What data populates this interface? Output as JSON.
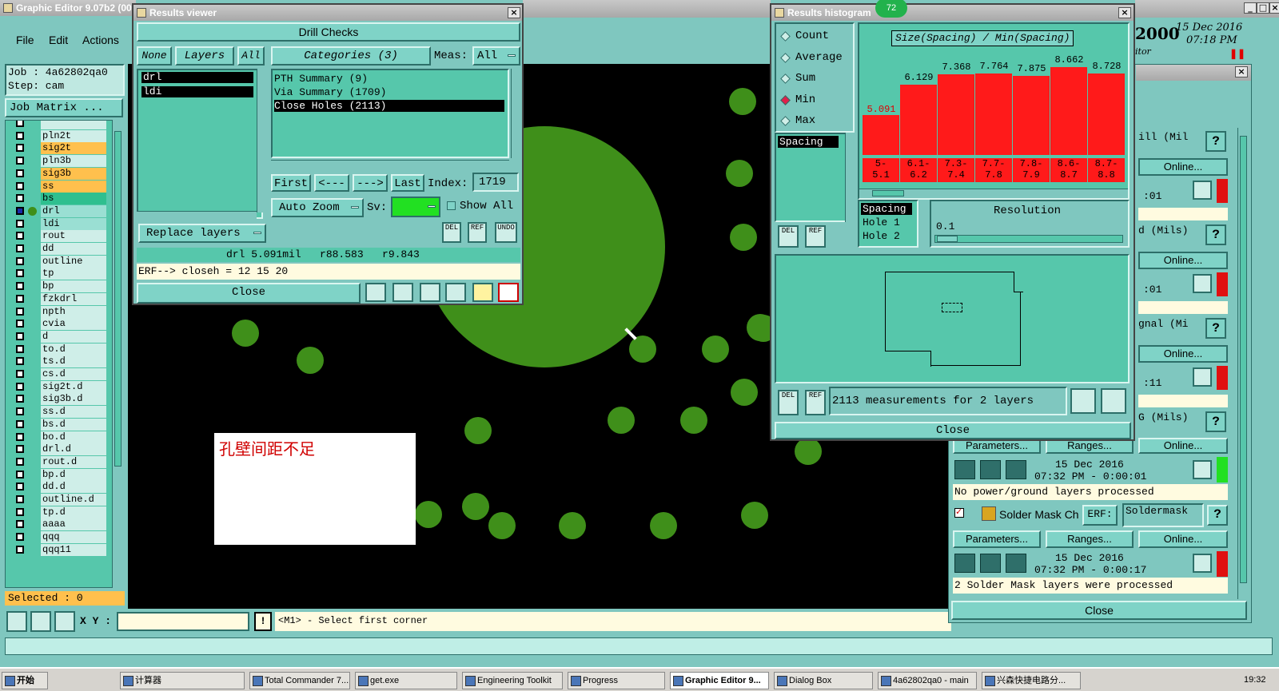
{
  "main_window": {
    "title": "Graphic Editor 9.07b2 (00",
    "menu": [
      "File",
      "Edit",
      "Actions"
    ],
    "job_line": "Job : 4a62802qa0",
    "step_line": "Step: cam",
    "job_matrix_label": "Job Matrix ...",
    "selected_label": "Selected : 0",
    "xy_label": "X Y :",
    "status_prompt": "<M1> - Select first corner",
    "date": "15 Dec 2016",
    "time": "07:18 PM",
    "year_fragment": "2000",
    "editor_fragment": "itor",
    "pause_icon": "❚❚"
  },
  "layers": [
    "",
    "pln2t",
    "sig2t",
    "pln3b",
    "sig3b",
    "ss",
    "bs",
    "drl",
    "ldi",
    "rout",
    "dd",
    "outline",
    "tp",
    "bp",
    "fzkdrl",
    "npth",
    "cvia",
    "d",
    "to.d",
    "ts.d",
    "cs.d",
    "sig2t.d",
    "sig3b.d",
    "ss.d",
    "bs.d",
    "bo.d",
    "drl.d",
    "rout.d",
    "bp.d",
    "dd.d",
    "outline.d",
    "tp.d",
    "aaaa",
    "qqq",
    "qqq11"
  ],
  "annotation": {
    "text": "孔壁间距不足"
  },
  "results_viewer": {
    "title": "Results viewer",
    "header": "Drill Checks",
    "none_label": "None",
    "layers_label": "Layers",
    "all_label": "All",
    "categories_label": "Categories (3)",
    "meas_label": "Meas:",
    "meas_value": "All",
    "layer_list": [
      "drl",
      "ldi"
    ],
    "category_list": [
      "PTH Summary (9)",
      "Via Summary (1709)",
      "Close Holes (2113)"
    ],
    "nav": {
      "first": "First",
      "prev": "<---",
      "next": "--->",
      "last": "Last",
      "index_label": "Index:",
      "index_value": "1719"
    },
    "auto_zoom": "Auto Zoom",
    "sv_label": "Sv:",
    "show_all": "Show All",
    "replace_layers": "Replace layers",
    "del": "DEL",
    "ref": "REF",
    "undo": "UNDO",
    "measure_line": "drl 5.091mil   r88.583   r9.843",
    "erf_line": "ERF--> closeh = 12 15 20",
    "close": "Close"
  },
  "histogram": {
    "title": "Results histogram",
    "badge": "72",
    "radio_options": [
      "Count",
      "Average",
      "Sum",
      "Min",
      "Max"
    ],
    "selected_option": "Min",
    "chart_title": "Size(Spacing) / Min(Spacing)",
    "bar_values": [
      "5.091",
      "6.129",
      "7.368",
      "7.764",
      "7.875",
      "8.662",
      "8.728"
    ],
    "bar_levels": [
      0.31,
      0.55,
      0.63,
      0.64,
      0.62,
      0.69,
      0.64
    ],
    "bin_labels_top": [
      "5-",
      "6.1-",
      "7.3-",
      "7.7-",
      "7.8-",
      "8.6-",
      "8.7-"
    ],
    "bin_labels_bottom": [
      "5.1",
      "6.2",
      "7.4",
      "7.8",
      "7.9",
      "8.7",
      "8.8"
    ],
    "left_list": [
      "Spacing"
    ],
    "field_list": [
      "Spacing",
      "Hole 1",
      "Hole 2"
    ],
    "resolution_label": "Resolution",
    "resolution_value": "0.1",
    "measurements": "2113 measurements for 2 layers",
    "close": "Close",
    "del": "DEL",
    "ref": "REF"
  },
  "checklist": {
    "rows": [
      {
        "label": "ill (Mil",
        "online": "Online...",
        "time": ":01"
      },
      {
        "label": "d (Mils)",
        "online": "Online...",
        "time": ":01"
      },
      {
        "label": "gnal (Mi",
        "online": "Online...",
        "time": ":11"
      },
      {
        "label": "G (Mils)",
        "online": "Online...",
        "time": ""
      }
    ],
    "help": "?",
    "params": "Parameters...",
    "ranges": "Ranges...",
    "date_line1": "15 Dec 2016",
    "time_line1": "07:32 PM - 0:00:01",
    "msg1": "No power/ground layers processed",
    "solder_label": "Solder Mask Ch",
    "erf_label": "ERF:",
    "soldermask": "Soldermask",
    "params2": "Parameters...",
    "ranges2": "Ranges...",
    "online2": "Online...",
    "date_line2": "15 Dec 2016",
    "time_line2": "07:32 PM - 0:00:17",
    "msg2": "2 Solder Mask layers were processed",
    "close": "Close"
  },
  "taskbar": {
    "start": "开始",
    "tasks": [
      "计算器",
      "Total Commander 7...",
      "get.exe",
      "Engineering Toolkit",
      "Progress",
      "Graphic Editor 9...",
      "Dialog Box",
      "4a62802qa0 - main",
      "兴森快捷电路分..."
    ],
    "clock": "19:32"
  },
  "colors": {
    "teal": "#56c7ab",
    "bar_red": "#ff1a1a",
    "pad_green": "#3f8f1a",
    "highlight_orange": "#ffc04d"
  }
}
